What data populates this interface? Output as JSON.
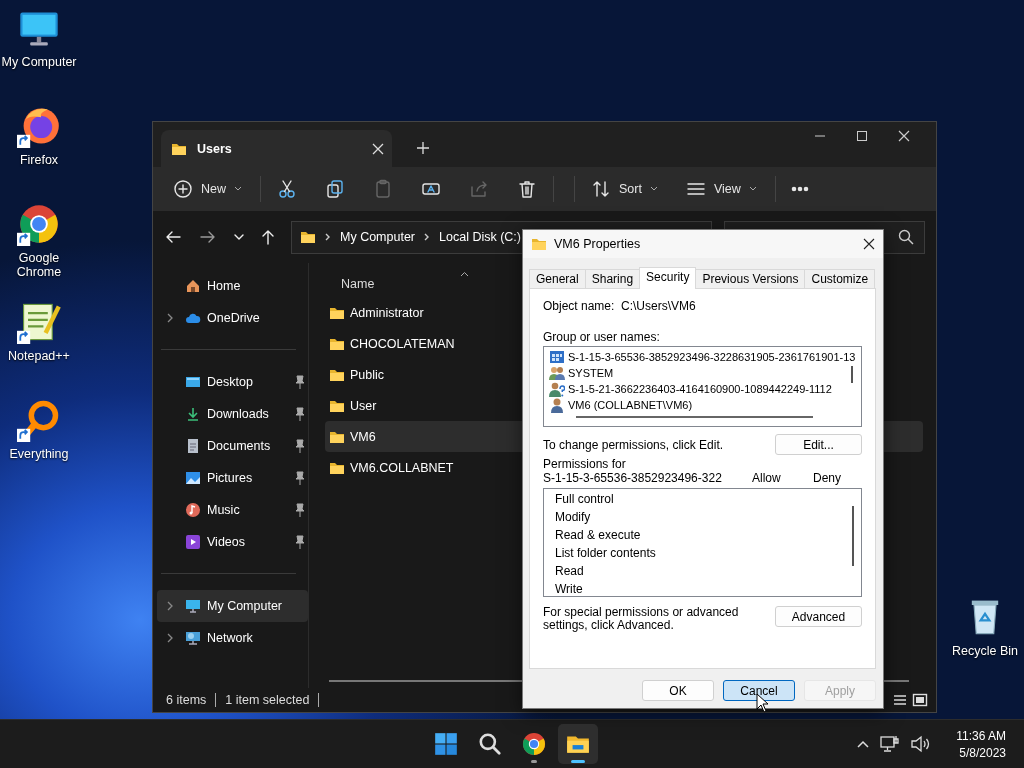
{
  "desktop_icons": [
    {
      "label": "My Computer",
      "kind": "computer",
      "shortcut": false
    },
    {
      "label": "Firefox",
      "kind": "firefox",
      "shortcut": true
    },
    {
      "label": "Google Chrome",
      "kind": "chrome",
      "shortcut": true
    },
    {
      "label": "Notepad++",
      "kind": "notepad",
      "shortcut": true
    },
    {
      "label": "Everything",
      "kind": "everything",
      "shortcut": true
    }
  ],
  "recycle_bin": {
    "label": "Recycle Bin"
  },
  "explorer": {
    "tab": {
      "title": "Users"
    },
    "toolbar": [
      {
        "kind": "new",
        "label": "New",
        "disabled": false
      },
      {
        "kind": "cut",
        "disabled": false
      },
      {
        "kind": "copy",
        "disabled": false
      },
      {
        "kind": "paste",
        "disabled": true
      },
      {
        "kind": "rename",
        "disabled": false
      },
      {
        "kind": "share",
        "disabled": true
      },
      {
        "kind": "delete",
        "disabled": false
      },
      {
        "kind": "sort",
        "label": "Sort",
        "disabled": false
      },
      {
        "kind": "view",
        "label": "View",
        "disabled": false
      },
      {
        "kind": "more",
        "disabled": false
      }
    ],
    "breadcrumbs": [
      "My Computer",
      "Local Disk (C:)"
    ],
    "sidebar": {
      "sections": [
        [
          {
            "label": "Home",
            "kind": "home",
            "expandable": false,
            "pinned": false,
            "selected": false
          },
          {
            "label": "OneDrive",
            "kind": "cloud",
            "expandable": true,
            "pinned": false,
            "selected": false
          }
        ],
        [
          {
            "label": "Desktop",
            "kind": "desktop",
            "expandable": false,
            "pinned": true,
            "selected": false
          },
          {
            "label": "Downloads",
            "kind": "downloads",
            "expandable": false,
            "pinned": true,
            "selected": false
          },
          {
            "label": "Documents",
            "kind": "documents",
            "expandable": false,
            "pinned": true,
            "selected": false
          },
          {
            "label": "Pictures",
            "kind": "pictures",
            "expandable": false,
            "pinned": true,
            "selected": false
          },
          {
            "label": "Music",
            "kind": "music",
            "expandable": false,
            "pinned": true,
            "selected": false
          },
          {
            "label": "Videos",
            "kind": "videos",
            "expandable": false,
            "pinned": true,
            "selected": false
          }
        ],
        [
          {
            "label": "My Computer",
            "kind": "computer",
            "expandable": true,
            "pinned": false,
            "selected": true
          },
          {
            "label": "Network",
            "kind": "network",
            "expandable": true,
            "pinned": false,
            "selected": false
          }
        ]
      ]
    },
    "files": {
      "columns": [
        "Name"
      ],
      "rows": [
        {
          "name": "Administrator",
          "selected": false
        },
        {
          "name": "CHOCOLATEMAN",
          "selected": false
        },
        {
          "name": "Public",
          "selected": false
        },
        {
          "name": "User",
          "selected": false
        },
        {
          "name": "VM6",
          "selected": true
        },
        {
          "name": "VM6.COLLABNET",
          "selected": false
        }
      ]
    },
    "status_bar": {
      "count": "6 items",
      "selection": "1 item selected"
    }
  },
  "dialog": {
    "title": "VM6 Properties",
    "tabs": [
      {
        "label": "General",
        "selected": false
      },
      {
        "label": "Sharing",
        "selected": false
      },
      {
        "label": "Security",
        "selected": true
      },
      {
        "label": "Previous Versions",
        "selected": false
      },
      {
        "label": "Customize",
        "selected": false
      }
    ],
    "object_name": {
      "label": "Object name:",
      "value": "C:\\Users\\VM6"
    },
    "group_label": "Group or user names:",
    "principals": [
      {
        "name": "S-1-15-3-65536-3852923496-3228631905-2361761901-13",
        "kind": "app"
      },
      {
        "name": "SYSTEM",
        "kind": "group"
      },
      {
        "name": "S-1-5-21-3662236403-4164160900-1089442249-1112",
        "kind": "unknown"
      },
      {
        "name": "VM6 (COLLABNET\\VM6)",
        "kind": "user"
      }
    ],
    "edit_hint": "To change permissions, click Edit.",
    "edit_button": "Edit...",
    "permissions_label": "Permissions for",
    "permissions_subject": "S-1-15-3-65536-3852923496-322",
    "allow_heading": "Allow",
    "deny_heading": "Deny",
    "permissions": [
      "Full control",
      "Modify",
      "Read & execute",
      "List folder contents",
      "Read",
      "Write"
    ],
    "advanced_hint": "For special permissions or advanced settings, click Advanced.",
    "advanced_button": "Advanced",
    "buttons": [
      {
        "label": "OK",
        "focused": false,
        "disabled": false
      },
      {
        "label": "Cancel",
        "focused": true,
        "disabled": false
      },
      {
        "label": "Apply",
        "focused": false,
        "disabled": true
      }
    ]
  },
  "taskbar": {
    "apps": [
      {
        "kind": "start",
        "running": false,
        "active": false
      },
      {
        "kind": "search",
        "running": false,
        "active": false
      },
      {
        "kind": "chrome",
        "running": true,
        "active": false
      },
      {
        "kind": "explorer",
        "running": true,
        "active": true
      }
    ],
    "clock": {
      "time": "11:36 AM",
      "date": "5/8/2023"
    }
  }
}
